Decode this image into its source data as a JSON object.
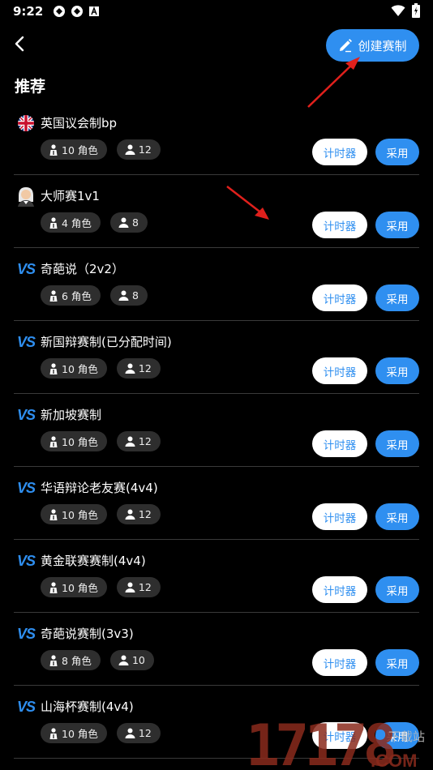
{
  "status": {
    "time": "9:22"
  },
  "header": {
    "create_label": "创建赛制"
  },
  "section": {
    "title": "推荐"
  },
  "items": [
    {
      "name": "英国议会制bp",
      "roles": "10 角色",
      "people": "12",
      "icon": "uk-flag-icon"
    },
    {
      "name": "大师赛1v1",
      "roles": "4 角色",
      "people": "8",
      "icon": "judge-avatar-icon"
    },
    {
      "name": "奇葩说（2v2）",
      "roles": "6 角色",
      "people": "8",
      "icon": "vs-icon"
    },
    {
      "name": "新国辩赛制(已分配时间)",
      "roles": "10 角色",
      "people": "12",
      "icon": "vs-icon"
    },
    {
      "name": "新加坡赛制",
      "roles": "10 角色",
      "people": "12",
      "icon": "vs-icon"
    },
    {
      "name": "华语辩论老友赛(4v4)",
      "roles": "10 角色",
      "people": "12",
      "icon": "vs-icon"
    },
    {
      "name": "黄金联赛赛制(4v4)",
      "roles": "10 角色",
      "people": "12",
      "icon": "vs-icon"
    },
    {
      "name": "奇葩说赛制(3v3)",
      "roles": "8 角色",
      "people": "10",
      "icon": "vs-icon"
    },
    {
      "name": "山海杯赛制(4v4)",
      "roles": "10 角色",
      "people": "12",
      "icon": "vs-icon"
    }
  ],
  "buttons": {
    "timer_label": "计时器",
    "adopt_label": "采用",
    "vs_label": "VS"
  },
  "watermark": {
    "text": "17178",
    "suffix": ".COM",
    "sub": "下载站"
  },
  "colors": {
    "accent": "#2f8ff0",
    "background": "#000000",
    "tag_bg": "#2e2e2e",
    "arrow": "#e0201c"
  }
}
